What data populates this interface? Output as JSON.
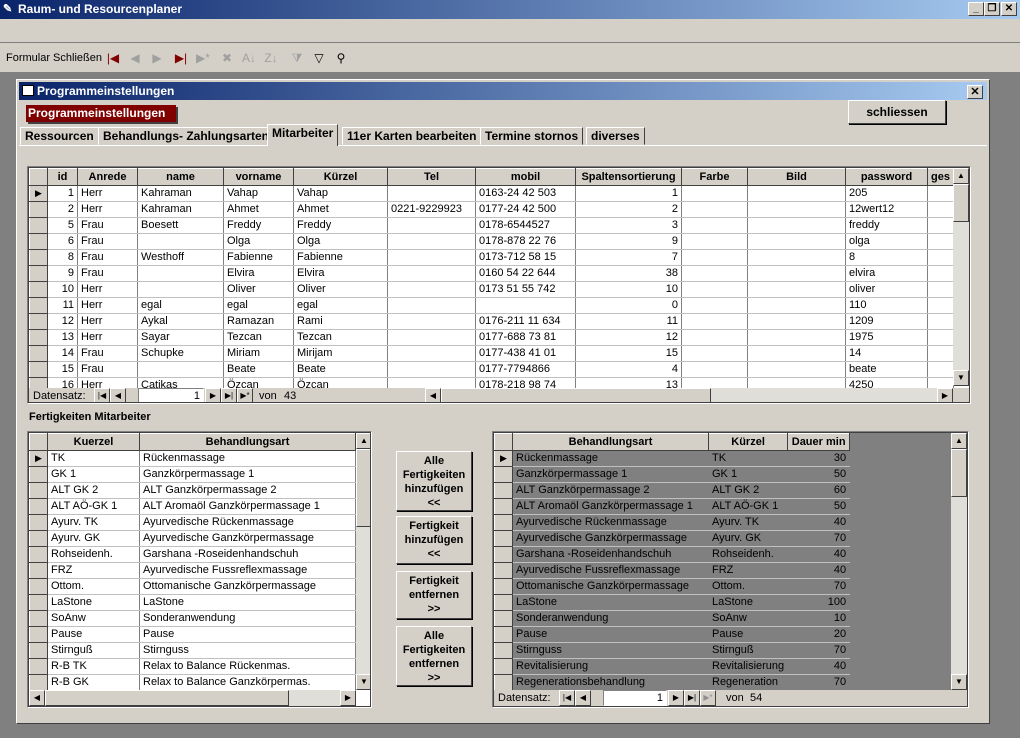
{
  "app": {
    "title": "Raum- und Resourcenplaner"
  },
  "toolbar": {
    "close_label": "Formular Schließen"
  },
  "form": {
    "title": "Programmeinstellungen",
    "header_label": "Programmeinstellungen",
    "close_button": "schliessen",
    "tabs": [
      "Ressourcen",
      "Behandlungs- Zahlungsarten",
      "Mitarbeiter",
      "11er Karten bearbeiten",
      "Termine stornos",
      "diverses"
    ]
  },
  "employees": {
    "columns": [
      "id",
      "Anrede",
      "name",
      "vorname",
      "Kürzel",
      "Tel",
      "mobil",
      "Spaltensortierung",
      "Farbe",
      "Bild",
      "password",
      "ges"
    ],
    "rows": [
      [
        "1",
        "Herr",
        "Kahraman",
        "Vahap",
        "Vahap",
        "",
        "0163-24 42 503",
        "1",
        "",
        "",
        "205"
      ],
      [
        "2",
        "Herr",
        "Kahraman",
        "Ahmet",
        "Ahmet",
        "0221-9229923",
        "0177-24 42 500",
        "2",
        "",
        "",
        "12wert12"
      ],
      [
        "5",
        "Frau",
        "Boesett",
        "Freddy",
        "Freddy",
        "",
        "0178-6544527",
        "3",
        "",
        "",
        "freddy"
      ],
      [
        "6",
        "Frau",
        "",
        "Olga",
        "Olga",
        "",
        "0178-878 22 76",
        "9",
        "",
        "",
        "olga"
      ],
      [
        "8",
        "Frau",
        "Westhoff",
        "Fabienne",
        "Fabienne",
        "",
        "0173-712 58 15",
        "7",
        "",
        "",
        "8"
      ],
      [
        "9",
        "Frau",
        "",
        "Elvira",
        "Elvira",
        "",
        "0160 54 22 644",
        "38",
        "",
        "",
        "elvira"
      ],
      [
        "10",
        "Herr",
        "",
        "Oliver",
        "Oliver",
        "",
        "0173 51 55 742",
        "10",
        "",
        "",
        "oliver"
      ],
      [
        "11",
        "Herr",
        "egal",
        "egal",
        "egal",
        "",
        "",
        "0",
        "",
        "",
        "110"
      ],
      [
        "12",
        "Herr",
        "Aykal",
        "Ramazan",
        "Rami",
        "",
        "0176-211 11 634",
        "11",
        "",
        "",
        "1209"
      ],
      [
        "13",
        "Herr",
        "Sayar",
        "Tezcan",
        "Tezcan",
        "",
        "0177-688 73 81",
        "12",
        "",
        "",
        "1975"
      ],
      [
        "14",
        "Frau",
        "Schupke",
        "Miriam",
        "Mirijam",
        "",
        "0177-438 41 01",
        "15",
        "",
        "",
        "14"
      ],
      [
        "15",
        "Frau",
        "",
        "Beate",
        "Beate",
        "",
        "0177-7794866",
        "4",
        "",
        "",
        "beate"
      ],
      [
        "16",
        "Herr",
        "Catikas",
        "Özcan",
        "Özcan",
        "",
        "0178-218 98 74",
        "13",
        "",
        "",
        "4250"
      ]
    ],
    "nav": {
      "label": "Datensatz:",
      "current": "1",
      "of_label": "von",
      "total": "43"
    }
  },
  "skills": {
    "title": "Fertigkeiten Mitarbeiter",
    "left": {
      "columns": [
        "Kuerzel",
        "Behandlungsart"
      ],
      "rows": [
        [
          "TK",
          "Rückenmassage"
        ],
        [
          "GK 1",
          "Ganzkörpermassage 1"
        ],
        [
          "ALT GK 2",
          "ALT Ganzkörpermassage 2"
        ],
        [
          "ALT AÖ-GK 1",
          "ALT Aromaöl Ganzkörpermassage 1"
        ],
        [
          "Ayurv. TK",
          "Ayurvedische Rückenmassage"
        ],
        [
          "Ayurv. GK",
          "Ayurvedische Ganzkörpermassage"
        ],
        [
          "Rohseidenh.",
          "Garshana -Roseidenhandschuh"
        ],
        [
          "FRZ",
          "Ayurvedische Fussreflexmassage"
        ],
        [
          "Ottom.",
          "Ottomanische Ganzkörpermassage"
        ],
        [
          "LaStone",
          "LaStone"
        ],
        [
          "SoAnw",
          "Sonderanwendung"
        ],
        [
          "Pause",
          "Pause"
        ],
        [
          "Stirnguß",
          "Stirnguss"
        ],
        [
          "R-B TK",
          "Relax to Balance Rückenmas."
        ],
        [
          "R-B GK",
          "Relax to Balance Ganzkörpermas."
        ]
      ]
    },
    "right": {
      "columns": [
        "Behandlungsart",
        "Kürzel",
        "Dauer min"
      ],
      "rows": [
        [
          "Rückenmassage",
          "TK",
          "30"
        ],
        [
          "Ganzkörpermassage 1",
          "GK 1",
          "50"
        ],
        [
          "ALT Ganzkörpermassage 2",
          "ALT GK 2",
          "60"
        ],
        [
          "ALT Aromaöl Ganzkörpermassage 1",
          "ALT AÖ-GK 1",
          "50"
        ],
        [
          "Ayurvedische Rückenmassage",
          "Ayurv. TK",
          "40"
        ],
        [
          "Ayurvedische Ganzkörpermassage",
          "Ayurv. GK",
          "70"
        ],
        [
          "Garshana -Roseidenhandschuh",
          "Rohseidenh.",
          "40"
        ],
        [
          "Ayurvedische Fussreflexmassage",
          "FRZ",
          "40"
        ],
        [
          "Ottomanische Ganzkörpermassage",
          "Ottom.",
          "70"
        ],
        [
          "LaStone",
          "LaStone",
          "100"
        ],
        [
          "Sonderanwendung",
          "SoAnw",
          "10"
        ],
        [
          "Pause",
          "Pause",
          "20"
        ],
        [
          "Stirnguss",
          "Stirnguß",
          "70"
        ],
        [
          "Revitalisierung",
          "Revitalisierung",
          "40"
        ],
        [
          "Regenerationsbehandlung",
          "Regeneration",
          "70"
        ]
      ],
      "nav": {
        "label": "Datensatz:",
        "current": "1",
        "of_label": "von",
        "total": "54"
      }
    },
    "buttons": [
      {
        "lines": [
          "Alle",
          "Fertigkeiten",
          "hinzufügen",
          "<<"
        ]
      },
      {
        "lines": [
          "Fertigkeit",
          "hinzufügen",
          "<<"
        ]
      },
      {
        "lines": [
          "Fertigkeit",
          "entfernen",
          ">>"
        ]
      },
      {
        "lines": [
          "Alle",
          "Fertigkeiten",
          "entfernen",
          ">>"
        ]
      }
    ]
  }
}
